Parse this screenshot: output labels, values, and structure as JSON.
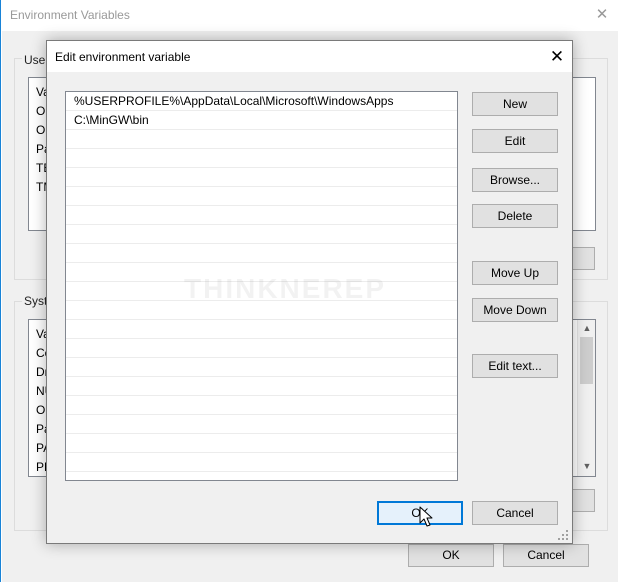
{
  "background_window": {
    "title": "Environment Variables",
    "user_section": {
      "label": "User",
      "list_rows": [
        "Va",
        "Or",
        "Or",
        "Pa",
        "TE",
        "TM"
      ]
    },
    "system_section": {
      "label": "Syste",
      "list_rows": [
        "Va",
        "Co",
        "Dr",
        "NU",
        "OS",
        "Pa",
        "PA",
        "PR"
      ]
    },
    "ok_label": "OK",
    "cancel_label": "Cancel"
  },
  "dialog": {
    "title": "Edit environment variable",
    "paths": [
      "%USERPROFILE%\\AppData\\Local\\Microsoft\\WindowsApps",
      "C:\\MinGW\\bin"
    ],
    "buttons": {
      "new": "New",
      "edit": "Edit",
      "browse": "Browse...",
      "delete": "Delete",
      "move_up": "Move Up",
      "move_down": "Move Down",
      "edit_text": "Edit text...",
      "ok": "OK",
      "cancel": "Cancel"
    },
    "watermark": "THINKNEREP"
  },
  "icons": {
    "close": "close-icon",
    "cursor": "mouse-pointer-icon",
    "resize_grip": "resize-grip-icon"
  },
  "colors": {
    "accent": "#0078d7",
    "window_border": "#1883d7",
    "button_face": "#e1e1e1",
    "dialog_bg": "#f0f0f0"
  }
}
